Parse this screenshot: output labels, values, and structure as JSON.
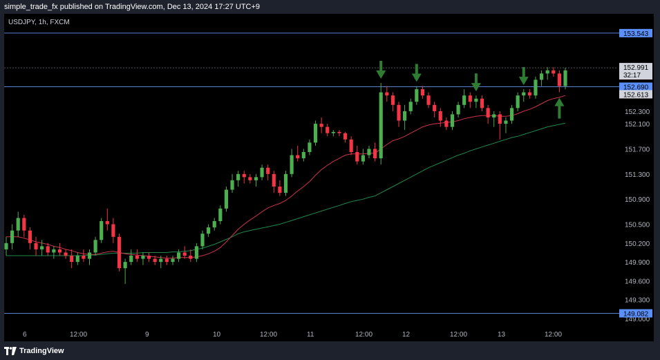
{
  "header": {
    "text": "simple_trade_fx published on TradingView.com, Dec 13, 2024 17:27 UTC+9"
  },
  "footer": {
    "brand": "TradingView"
  },
  "chart_data": {
    "type": "candlestick",
    "symbol_label": "USDJPY, 1h, FXCM",
    "y_axis": {
      "min": 148.9,
      "max": 153.85,
      "ticks": [
        "153.543",
        "152.991",
        "152.690",
        "152.613",
        "152.300",
        "152.100",
        "151.700",
        "151.300",
        "150.900",
        "150.500",
        "150.200",
        "149.900",
        "149.600",
        "149.300",
        "149.082",
        "149.000"
      ]
    },
    "price_labels": {
      "current": {
        "value": "152.991",
        "countdown": "32:17"
      },
      "level_label": "152.690",
      "prev": "152.613",
      "lines": [
        "153.543",
        "149.082"
      ]
    },
    "x_labels": [
      "6",
      "12:00",
      "9",
      "10",
      "12:00",
      "11",
      "12:00",
      "12",
      "12:00",
      "13",
      "12:00"
    ],
    "horizontal_lines": [
      153.543,
      152.69,
      149.082
    ],
    "dotted_line": 152.991,
    "colors": {
      "up": "#4caf50",
      "down": "#f23645",
      "ema_fast": "#d0334a",
      "ema_slow": "#1f8a4c",
      "hline": "#5c7fd4",
      "arrow": "#2e7d32",
      "label_blue": "#5b8ff9",
      "label_gray": "#d1d4dc"
    },
    "ohlc": [
      [
        150.1,
        150.3,
        150.0,
        150.2
      ],
      [
        150.2,
        150.5,
        150.1,
        150.4
      ],
      [
        150.4,
        150.7,
        150.3,
        150.6
      ],
      [
        150.6,
        150.65,
        150.3,
        150.4
      ],
      [
        150.4,
        150.45,
        150.1,
        150.2
      ],
      [
        150.2,
        150.3,
        150.0,
        150.1
      ],
      [
        150.1,
        150.25,
        150.0,
        150.15
      ],
      [
        150.15,
        150.2,
        150.0,
        150.05
      ],
      [
        150.05,
        150.15,
        149.95,
        150.1
      ],
      [
        150.1,
        150.2,
        150.0,
        150.05
      ],
      [
        150.05,
        150.1,
        149.95,
        150.0
      ],
      [
        150.0,
        150.1,
        149.8,
        149.9
      ],
      [
        149.9,
        150.05,
        149.85,
        150.0
      ],
      [
        150.0,
        150.1,
        149.9,
        149.95
      ],
      [
        149.95,
        150.1,
        149.85,
        150.05
      ],
      [
        150.05,
        150.3,
        150.0,
        150.25
      ],
      [
        150.25,
        150.6,
        150.2,
        150.55
      ],
      [
        150.55,
        150.75,
        150.4,
        150.5
      ],
      [
        150.5,
        150.6,
        150.2,
        150.3
      ],
      [
        150.3,
        150.35,
        149.75,
        149.8
      ],
      [
        149.8,
        149.95,
        149.55,
        149.9
      ],
      [
        149.9,
        150.1,
        149.85,
        150.0
      ],
      [
        150.0,
        150.1,
        149.9,
        149.95
      ],
      [
        149.95,
        150.05,
        149.85,
        150.0
      ],
      [
        150.0,
        150.05,
        149.9,
        149.95
      ],
      [
        149.95,
        150.0,
        149.85,
        149.9
      ],
      [
        149.9,
        150.0,
        149.8,
        149.95
      ],
      [
        149.95,
        150.0,
        149.85,
        149.9
      ],
      [
        149.9,
        150.0,
        149.85,
        149.95
      ],
      [
        149.95,
        150.1,
        149.9,
        150.05
      ],
      [
        150.05,
        150.15,
        149.95,
        150.0
      ],
      [
        150.0,
        150.1,
        149.9,
        149.95
      ],
      [
        149.95,
        150.2,
        149.9,
        150.15
      ],
      [
        150.15,
        150.4,
        150.1,
        150.35
      ],
      [
        150.35,
        150.5,
        150.3,
        150.45
      ],
      [
        150.45,
        150.6,
        150.4,
        150.55
      ],
      [
        150.55,
        150.8,
        150.5,
        150.75
      ],
      [
        150.75,
        151.1,
        150.7,
        151.05
      ],
      [
        151.05,
        151.3,
        151.0,
        151.2
      ],
      [
        151.2,
        151.35,
        151.1,
        151.3
      ],
      [
        151.3,
        151.35,
        151.15,
        151.25
      ],
      [
        151.25,
        151.3,
        151.15,
        151.2
      ],
      [
        151.2,
        151.3,
        151.1,
        151.25
      ],
      [
        151.25,
        151.45,
        151.2,
        151.4
      ],
      [
        151.4,
        151.45,
        151.2,
        151.3
      ],
      [
        151.3,
        151.35,
        151.0,
        151.1
      ],
      [
        151.1,
        151.2,
        150.95,
        151.0
      ],
      [
        151.0,
        151.35,
        150.95,
        151.3
      ],
      [
        151.3,
        151.7,
        151.25,
        151.6
      ],
      [
        151.6,
        151.75,
        151.5,
        151.55
      ],
      [
        151.55,
        151.7,
        151.5,
        151.65
      ],
      [
        151.65,
        151.85,
        151.6,
        151.8
      ],
      [
        151.8,
        152.15,
        151.75,
        152.1
      ],
      [
        152.1,
        152.2,
        151.95,
        152.05
      ],
      [
        152.05,
        152.1,
        151.9,
        151.95
      ],
      [
        151.95,
        152.0,
        151.9,
        151.97
      ],
      [
        151.97,
        152.0,
        151.9,
        151.95
      ],
      [
        151.95,
        151.97,
        151.8,
        151.85
      ],
      [
        151.85,
        151.9,
        151.6,
        151.65
      ],
      [
        151.65,
        151.75,
        151.45,
        151.5
      ],
      [
        151.5,
        151.7,
        151.45,
        151.6
      ],
      [
        151.6,
        151.75,
        151.55,
        151.7
      ],
      [
        151.7,
        151.8,
        151.5,
        151.55
      ],
      [
        151.55,
        152.75,
        151.45,
        152.6
      ],
      [
        152.6,
        152.7,
        152.45,
        152.55
      ],
      [
        152.55,
        152.6,
        152.3,
        152.4
      ],
      [
        152.4,
        152.45,
        152.05,
        152.15
      ],
      [
        152.15,
        152.4,
        152.0,
        152.3
      ],
      [
        152.3,
        152.5,
        152.25,
        152.45
      ],
      [
        152.45,
        152.7,
        152.4,
        152.65
      ],
      [
        152.65,
        152.7,
        152.5,
        152.55
      ],
      [
        152.55,
        152.6,
        152.35,
        152.4
      ],
      [
        152.4,
        152.45,
        152.2,
        152.3
      ],
      [
        152.3,
        152.35,
        152.05,
        152.15
      ],
      [
        152.15,
        152.2,
        152.0,
        152.05
      ],
      [
        152.05,
        152.3,
        152.0,
        152.25
      ],
      [
        152.25,
        152.45,
        152.2,
        152.4
      ],
      [
        152.4,
        152.65,
        152.35,
        152.55
      ],
      [
        152.55,
        152.6,
        152.35,
        152.45
      ],
      [
        152.45,
        152.55,
        152.35,
        152.5
      ],
      [
        152.5,
        152.55,
        152.3,
        152.35
      ],
      [
        152.35,
        152.4,
        152.1,
        152.2
      ],
      [
        152.2,
        152.3,
        152.05,
        152.25
      ],
      [
        152.25,
        152.3,
        151.85,
        152.1
      ],
      [
        152.1,
        152.2,
        151.95,
        152.15
      ],
      [
        152.15,
        152.4,
        152.1,
        152.35
      ],
      [
        152.35,
        152.6,
        152.3,
        152.55
      ],
      [
        152.55,
        152.65,
        152.45,
        152.6
      ],
      [
        152.6,
        152.65,
        152.5,
        152.55
      ],
      [
        152.55,
        152.85,
        152.5,
        152.8
      ],
      [
        152.8,
        152.95,
        152.7,
        152.9
      ],
      [
        152.9,
        153.0,
        152.8,
        152.95
      ],
      [
        152.95,
        153.0,
        152.85,
        152.9
      ],
      [
        152.9,
        152.95,
        152.6,
        152.7
      ],
      [
        152.7,
        152.99,
        152.65,
        152.95
      ]
    ],
    "ema_fast": [
      150.3,
      150.3,
      150.3,
      150.28,
      150.25,
      150.22,
      150.2,
      150.18,
      150.15,
      150.13,
      150.1,
      150.08,
      150.05,
      150.03,
      150.02,
      150.02,
      150.04,
      150.06,
      150.07,
      150.05,
      150.03,
      150.02,
      150.01,
      150.0,
      149.99,
      149.98,
      149.97,
      149.96,
      149.96,
      149.97,
      149.97,
      149.97,
      149.98,
      150.0,
      150.03,
      150.07,
      150.13,
      150.22,
      150.32,
      150.42,
      150.5,
      150.57,
      150.63,
      150.7,
      150.76,
      150.8,
      150.83,
      150.88,
      150.95,
      151.03,
      151.1,
      151.18,
      151.28,
      151.37,
      151.44,
      151.5,
      151.55,
      151.6,
      151.62,
      151.62,
      151.62,
      151.63,
      151.63,
      151.7,
      151.77,
      151.83,
      151.86,
      151.9,
      151.95,
      152.0,
      152.05,
      152.08,
      152.1,
      152.11,
      152.12,
      152.13,
      152.15,
      152.18,
      152.2,
      152.22,
      152.23,
      152.23,
      152.23,
      152.22,
      152.22,
      152.23,
      152.26,
      152.3,
      152.33,
      152.37,
      152.42,
      152.47,
      152.5,
      152.52,
      152.55
    ],
    "ema_slow": [
      150.0,
      150.0,
      150.0,
      150.0,
      150.0,
      150.0,
      150.0,
      150.0,
      150.0,
      150.0,
      150.0,
      150.0,
      150.0,
      150.0,
      150.01,
      150.01,
      150.02,
      150.03,
      150.04,
      150.04,
      150.04,
      150.04,
      150.04,
      150.05,
      150.05,
      150.05,
      150.05,
      150.05,
      150.06,
      150.06,
      150.07,
      150.08,
      150.1,
      150.12,
      150.15,
      150.18,
      150.22,
      150.26,
      150.3,
      150.35,
      150.38,
      150.4,
      150.42,
      150.44,
      150.46,
      150.48,
      150.5,
      150.53,
      150.56,
      150.59,
      150.62,
      150.65,
      150.68,
      150.71,
      150.74,
      150.77,
      150.8,
      150.83,
      150.86,
      150.88,
      150.9,
      150.93,
      150.95,
      151.0,
      151.05,
      151.1,
      151.15,
      151.2,
      151.25,
      151.3,
      151.35,
      151.4,
      151.44,
      151.48,
      151.52,
      151.56,
      151.6,
      151.63,
      151.67,
      151.7,
      151.73,
      151.76,
      151.79,
      151.82,
      151.85,
      151.88,
      151.9,
      151.93,
      151.96,
      151.99,
      152.02,
      152.05,
      152.07,
      152.09,
      152.11
    ],
    "arrows": [
      {
        "type": "down",
        "candle": 63
      },
      {
        "type": "down",
        "candle": 69
      },
      {
        "type": "down",
        "candle": 79
      },
      {
        "type": "down",
        "candle": 87
      },
      {
        "type": "up",
        "candle": 93
      }
    ]
  }
}
